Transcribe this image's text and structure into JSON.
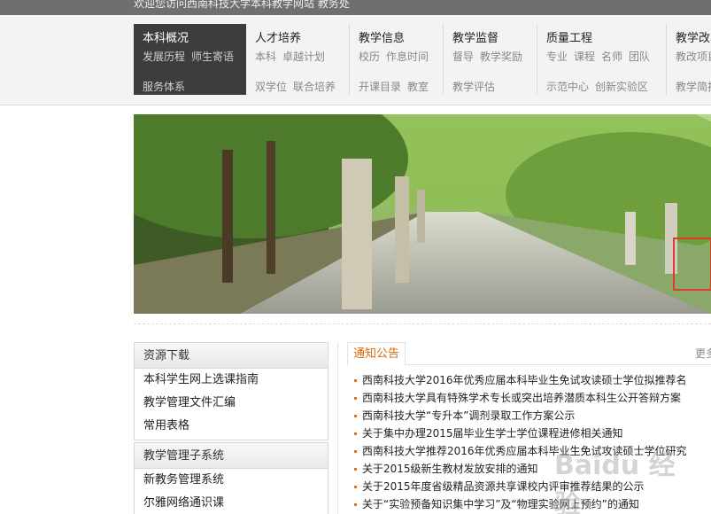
{
  "topbar": {
    "welcome": "欢迎您访问西南科技大学本科教学网站 教务处"
  },
  "nav": [
    {
      "title": "本科概况",
      "row1": [
        "发展历程",
        "师生寄语"
      ],
      "row2": [
        "服务体系"
      ],
      "active": true
    },
    {
      "title": "人才培养",
      "row1": [
        "本科",
        "卓越计划"
      ],
      "row2": [
        "双学位",
        "联合培养"
      ]
    },
    {
      "title": "教学信息",
      "row1": [
        "校历",
        "作息时间"
      ],
      "row2": [
        "开课目录",
        "教室"
      ]
    },
    {
      "title": "教学监督",
      "row1": [
        "督导",
        "教学奖励"
      ],
      "row2": [
        "教学评估"
      ]
    },
    {
      "title": "质量工程",
      "row1": [
        "专业",
        "课程",
        "名师",
        "团队"
      ],
      "row2": [
        "示范中心",
        "创新实验区"
      ]
    },
    {
      "title": "教学改革",
      "row1": [
        "教改项目"
      ],
      "row2": [
        "教学简报"
      ]
    }
  ],
  "sidebar": {
    "resources": {
      "title": "资源下载",
      "items": [
        "本科学生网上选课指南",
        "教学管理文件汇编",
        "常用表格"
      ]
    },
    "systems": {
      "title": "教学管理子系统",
      "items": [
        "新教务管理系统",
        "尔雅网络通识课"
      ]
    }
  },
  "notice": {
    "tab": "通知公告",
    "more": "更多",
    "items": [
      "西南科技大学2016年优秀应届本科毕业生免试攻读硕士学位拟推荐名",
      "西南科技大学具有特殊学术专长或突出培养潜质本科生公开答辩方案",
      "西南科技大学“专升本”调剂录取工作方案公示",
      "关于集中办理2015届毕业生学士学位课程进修相关通知",
      "西南科技大学推荐2016年优秀应届本科毕业生免试攻读硕士学位研究",
      "关于2015级新生教材发放安排的通知",
      "关于2015年度省级精品资源共享课校内评审推荐结果的公示",
      "关于“实验预备知识集中学习”及“物理实验网上预约”的通知"
    ]
  },
  "watermark": {
    "text": "Baidu 经验"
  },
  "colors": {
    "accent": "#d86b0a",
    "active_nav": "#3d3d3d",
    "topbar": "#6f6f6f"
  },
  "icons": {
    "bullet": "square-bullet-icon"
  }
}
